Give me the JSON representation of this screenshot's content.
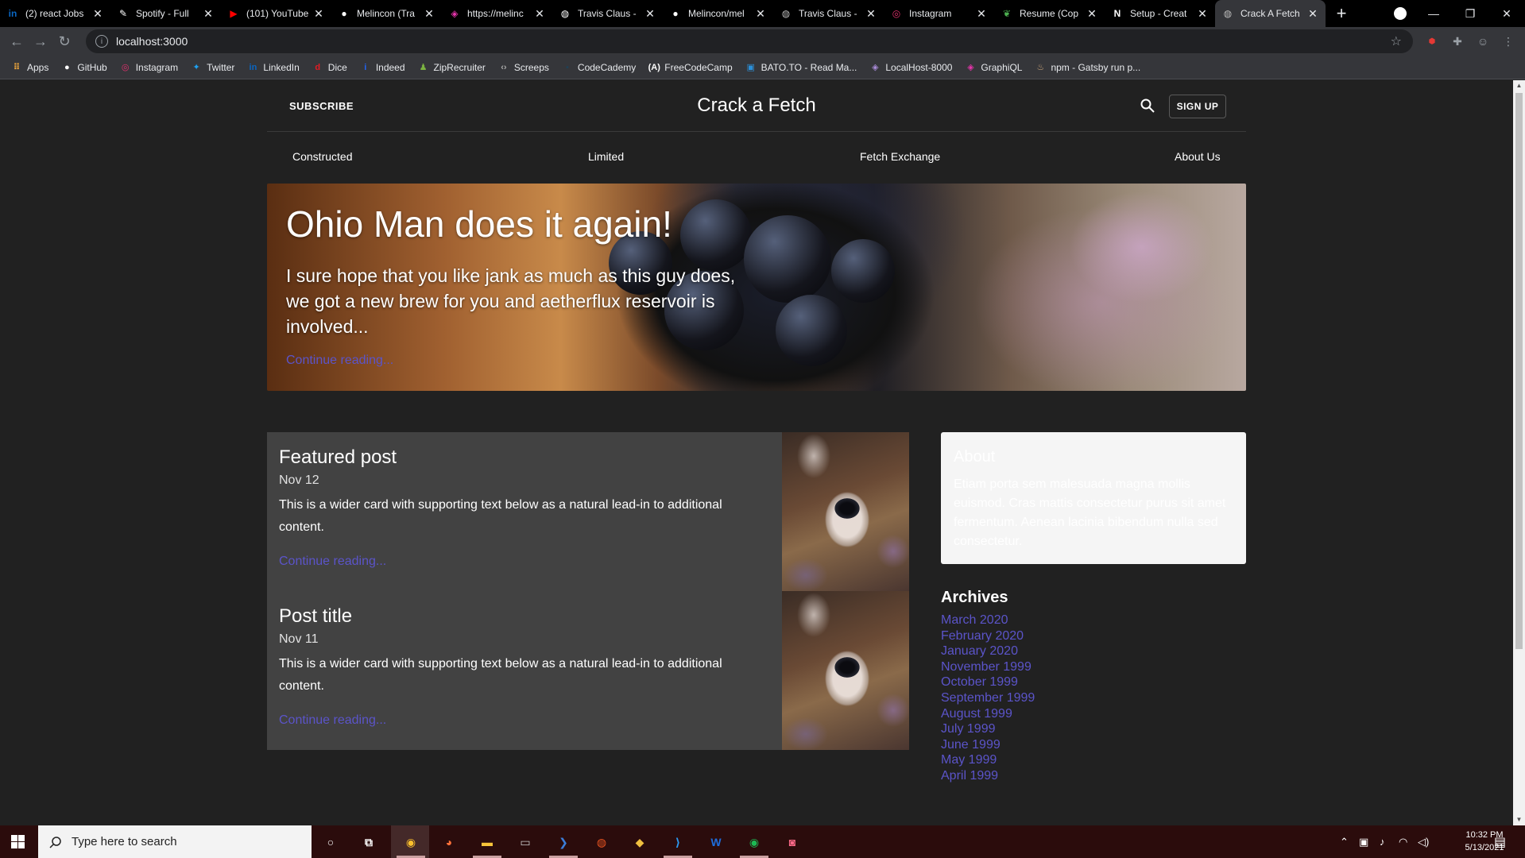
{
  "browser": {
    "tabs": [
      {
        "title": "(2) react Jobs",
        "icon": "linkedin-icon",
        "color": "#0a66c2",
        "glyph": "in"
      },
      {
        "title": "Spotify - Full",
        "icon": "pen-icon",
        "color": "#ffffff",
        "glyph": "✎"
      },
      {
        "title": "(101) YouTube",
        "icon": "youtube-icon",
        "color": "#ff0000",
        "glyph": "▶"
      },
      {
        "title": "Melincon (Tra",
        "icon": "github-icon",
        "color": "#ffffff",
        "glyph": "●"
      },
      {
        "title": "https://melinc",
        "icon": "graphql-icon",
        "color": "#e535ab",
        "glyph": "◈"
      },
      {
        "title": "Travis Claus -",
        "icon": "globe-icon",
        "color": "#ffffff",
        "glyph": "◍"
      },
      {
        "title": "Melincon/mel",
        "icon": "github-icon",
        "color": "#ffffff",
        "glyph": "●"
      },
      {
        "title": "Travis Claus -",
        "icon": "globe-icon",
        "color": "#bbbbbb",
        "glyph": "◍"
      },
      {
        "title": "Instagram",
        "icon": "instagram-icon",
        "color": "#e1306c",
        "glyph": "◎"
      },
      {
        "title": "Resume (Cop",
        "icon": "leaf-icon",
        "color": "#4caf50",
        "glyph": "❦"
      },
      {
        "title": "Setup - Creat",
        "icon": "n-icon",
        "color": "#ffffff",
        "glyph": "N"
      },
      {
        "title": "Crack A Fetch",
        "icon": "globe-icon",
        "color": "#bbbbbb",
        "glyph": "◍",
        "active": true
      }
    ],
    "url": "localhost:3000",
    "bookmarks": [
      {
        "label": "Apps",
        "icon": "apps-icon",
        "color": "#e8a33c",
        "glyph": "⠿"
      },
      {
        "label": "GitHub",
        "icon": "github-icon",
        "color": "#ffffff",
        "glyph": "●"
      },
      {
        "label": "Instagram",
        "icon": "instagram-icon",
        "color": "#e1306c",
        "glyph": "◎"
      },
      {
        "label": "Twitter",
        "icon": "twitter-icon",
        "color": "#1da1f2",
        "glyph": "✦"
      },
      {
        "label": "LinkedIn",
        "icon": "linkedin-icon",
        "color": "#0a66c2",
        "glyph": "in"
      },
      {
        "label": "Dice",
        "icon": "dice-icon",
        "color": "#e31b23",
        "glyph": "d"
      },
      {
        "label": "Indeed",
        "icon": "indeed-icon",
        "color": "#2164f3",
        "glyph": "i"
      },
      {
        "label": "ZipRecruiter",
        "icon": "ziprecruiter-icon",
        "color": "#7bb241",
        "glyph": "♟"
      },
      {
        "label": "Screeps",
        "icon": "code-icon",
        "color": "#aaaaaa",
        "glyph": "‹›"
      },
      {
        "label": "CodeCademy",
        "icon": "codecademy-icon",
        "color": "#1f4056",
        "glyph": "▪"
      },
      {
        "label": "FreeCodeCamp",
        "icon": "freecodecamp-icon",
        "color": "#ffffff",
        "glyph": "(A)"
      },
      {
        "label": "BATO.TO - Read Ma...",
        "icon": "bato-icon",
        "color": "#2a8fd8",
        "glyph": "▣"
      },
      {
        "label": "LocalHost-8000",
        "icon": "graphql-icon",
        "color": "#a98bd8",
        "glyph": "◈"
      },
      {
        "label": "GraphiQL",
        "icon": "graphql-icon",
        "color": "#e535ab",
        "glyph": "◈"
      },
      {
        "label": "npm - Gatsby run p...",
        "icon": "npm-icon",
        "color": "#c8a47a",
        "glyph": "♨"
      }
    ]
  },
  "site": {
    "subscribe": "SUBSCRIBE",
    "title": "Crack a Fetch",
    "signup": "SIGN UP",
    "nav": [
      "Constructed",
      "Limited",
      "Fetch Exchange",
      "About Us"
    ],
    "hero": {
      "title": "Ohio Man does it again!",
      "text": "I sure hope that you like jank as much as this guy does, we got a new brew for you and aetherflux reservoir is involved...",
      "link": "Continue reading..."
    },
    "posts": [
      {
        "title": "Featured post",
        "date": "Nov 12",
        "text": "This is a wider card with supporting text below as a natural lead-in to additional content.",
        "link": "Continue reading..."
      },
      {
        "title": "Post title",
        "date": "Nov 11",
        "text": "This is a wider card with supporting text below as a natural lead-in to additional content.",
        "link": "Continue reading..."
      }
    ],
    "about": {
      "title": "About",
      "text": "Etiam porta sem malesuada magna mollis euismod. Cras mattis consectetur purus sit amet fermentum. Aenean lacinia bibendum nulla sed consectetur."
    },
    "archives_title": "Archives",
    "archives": [
      "March 2020",
      "February 2020",
      "January 2020",
      "November 1999",
      "October 1999",
      "September 1999",
      "August 1999",
      "July 1999",
      "June 1999",
      "May 1999",
      "April 1999"
    ]
  },
  "taskbar": {
    "search_placeholder": "Type here to search",
    "apps": [
      {
        "name": "cortana-icon",
        "glyph": "○",
        "color": "#ffffff"
      },
      {
        "name": "task-view-icon",
        "glyph": "⧉",
        "color": "#ffffff"
      },
      {
        "name": "chrome-icon",
        "glyph": "◉",
        "color": "#fbc02d"
      },
      {
        "name": "firefox-icon",
        "glyph": "◕",
        "color": "#ff7139"
      },
      {
        "name": "file-explorer-icon",
        "glyph": "▬",
        "color": "#f8c43a"
      },
      {
        "name": "terminal-icon",
        "glyph": "▭",
        "color": "#cccccc"
      },
      {
        "name": "powershell-icon",
        "glyph": "❯",
        "color": "#3b7dd8"
      },
      {
        "name": "ubuntu-icon",
        "glyph": "◍",
        "color": "#e95420"
      },
      {
        "name": "gitkraken-icon",
        "glyph": "◆",
        "color": "#f0c040"
      },
      {
        "name": "vscode-icon",
        "glyph": "⟩",
        "color": "#2b9af3"
      },
      {
        "name": "word-icon",
        "glyph": "W",
        "color": "#1e6ddd"
      },
      {
        "name": "spotify-icon",
        "glyph": "◉",
        "color": "#1db954"
      },
      {
        "name": "discord-icon",
        "glyph": "◙",
        "color": "#ff6b8a"
      }
    ],
    "time": "10:32 PM",
    "date": "5/13/2021"
  }
}
